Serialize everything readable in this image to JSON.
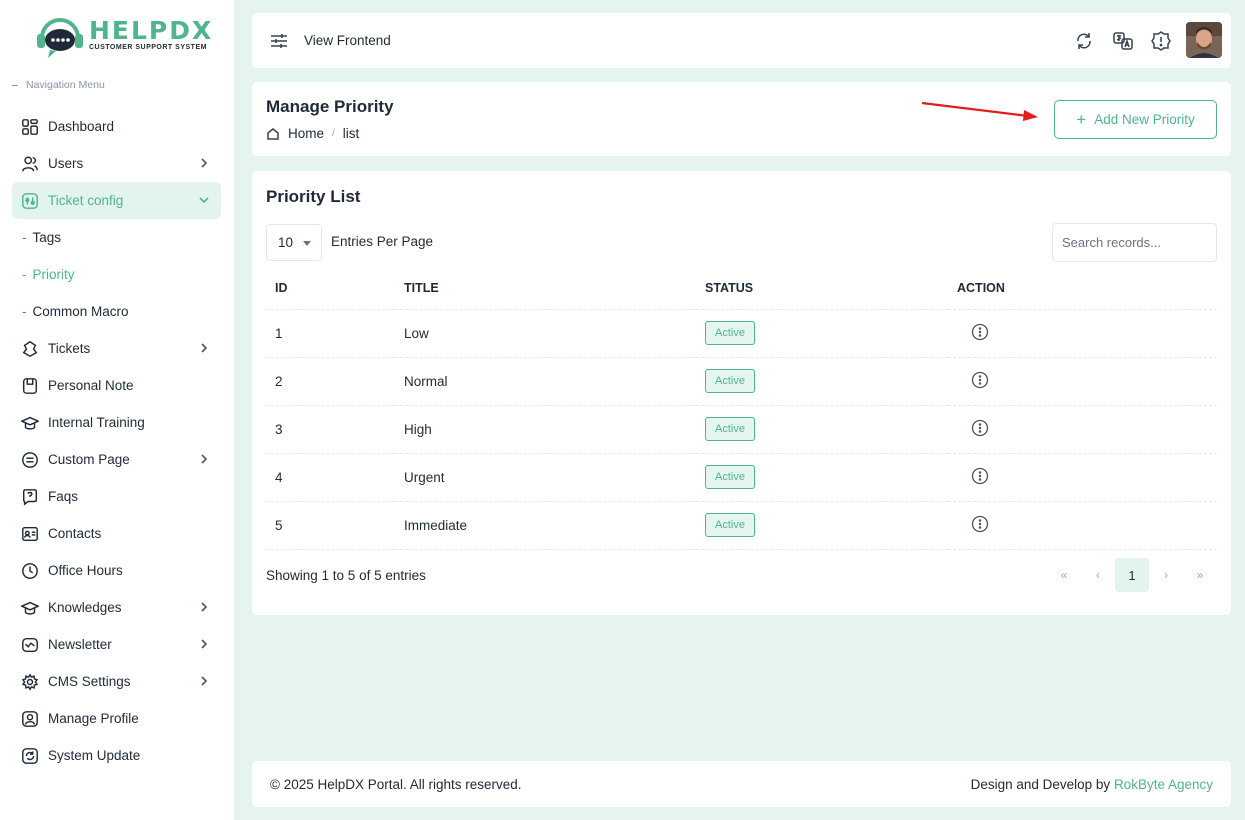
{
  "brand": {
    "name": "HELPDX",
    "tagline": "CUSTOMER SUPPORT SYSTEM"
  },
  "sidebar": {
    "heading": "Navigation Menu",
    "items": [
      {
        "label": "Dashboard",
        "icon": "dashboard-icon"
      },
      {
        "label": "Users",
        "icon": "users-icon"
      },
      {
        "label": "Ticket config",
        "icon": "ticket-config-icon"
      },
      {
        "label": "Tags"
      },
      {
        "label": "Priority"
      },
      {
        "label": "Common Macro"
      },
      {
        "label": "Tickets",
        "icon": "tickets-icon"
      },
      {
        "label": "Personal Note",
        "icon": "note-icon"
      },
      {
        "label": "Internal Training",
        "icon": "training-icon"
      },
      {
        "label": "Custom Page",
        "icon": "page-icon"
      },
      {
        "label": "Faqs",
        "icon": "faq-icon"
      },
      {
        "label": "Contacts",
        "icon": "contacts-icon"
      },
      {
        "label": "Office Hours",
        "icon": "clock-icon"
      },
      {
        "label": "Knowledges",
        "icon": "knowledge-icon"
      },
      {
        "label": "Newsletter",
        "icon": "newsletter-icon"
      },
      {
        "label": "CMS Settings",
        "icon": "gear-icon"
      },
      {
        "label": "Manage Profile",
        "icon": "profile-icon"
      },
      {
        "label": "System Update",
        "icon": "update-icon"
      }
    ]
  },
  "topbar": {
    "view_frontend": "View Frontend"
  },
  "header": {
    "title": "Manage Priority",
    "breadcrumb_home": "Home",
    "breadcrumb_sep": "/",
    "breadcrumb_current": "list",
    "add_button": "Add New Priority"
  },
  "list": {
    "title": "Priority List",
    "entries_value": "10",
    "entries_label": "Entries Per Page",
    "search_placeholder": "Search records...",
    "columns": [
      "ID",
      "TITLE",
      "STATUS",
      "ACTION"
    ],
    "rows": [
      {
        "id": "1",
        "title": "Low",
        "status": "Active"
      },
      {
        "id": "2",
        "title": "Normal",
        "status": "Active"
      },
      {
        "id": "3",
        "title": "High",
        "status": "Active"
      },
      {
        "id": "4",
        "title": "Urgent",
        "status": "Active"
      },
      {
        "id": "5",
        "title": "Immediate",
        "status": "Active"
      }
    ],
    "showing": "Showing 1 to 5 of 5 entries",
    "pager": {
      "first": "«",
      "prev": "‹",
      "current": "1",
      "next": "›",
      "last": "»"
    }
  },
  "footer": {
    "copyright": "© 2025 HelpDX Portal. All rights reserved.",
    "credit_prefix": "Design and Develop by ",
    "credit_agency": "RokByte Agency"
  },
  "colors": {
    "accent": "#4fb48f",
    "background": "#e6f4f0",
    "arrow": "#e11d1d"
  }
}
